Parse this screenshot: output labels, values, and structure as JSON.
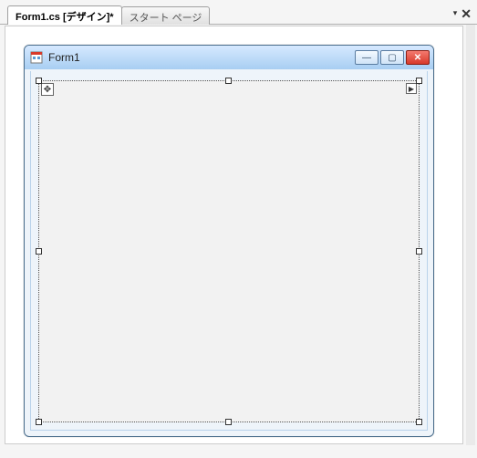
{
  "tabs": {
    "active": "Form1.cs [デザイン]*",
    "inactive": "スタート ページ"
  },
  "window": {
    "title": "Form1"
  },
  "glyphs": {
    "move": "✥",
    "smart_tag": "▶",
    "dropdown": "▾",
    "close_doc": "✕",
    "min": "—",
    "max": "▢",
    "close": "✕"
  }
}
